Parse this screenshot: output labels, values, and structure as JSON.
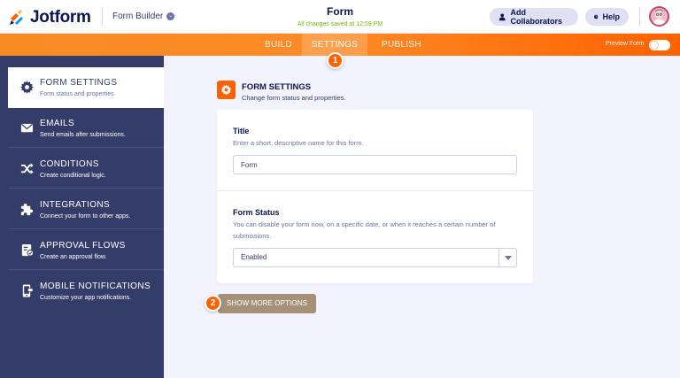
{
  "header": {
    "brand": "Jotform",
    "builder_label": "Form Builder",
    "builder_chevron": "⌄",
    "form_title": "Form",
    "save_status": "All changes saved at 12:59 PM",
    "add_collaborators": "Add Collaborators",
    "help": "Help"
  },
  "nav": {
    "tabs": [
      "BUILD",
      "SETTINGS",
      "PUBLISH"
    ],
    "active_tab": "SETTINGS",
    "preview_label": "Preview Form"
  },
  "markers": [
    "1",
    "2"
  ],
  "sidebar": {
    "items": [
      {
        "title": "FORM SETTINGS",
        "subtitle": "Form status and properties.",
        "icon": "gear-icon",
        "active": true
      },
      {
        "title": "EMAILS",
        "subtitle": "Send emails after submissions.",
        "icon": "envelope-icon",
        "active": false
      },
      {
        "title": "CONDITIONS",
        "subtitle": "Create conditional logic.",
        "icon": "shuffle-icon",
        "active": false
      },
      {
        "title": "INTEGRATIONS",
        "subtitle": "Connect your form to other apps.",
        "icon": "puzzle-icon",
        "active": false
      },
      {
        "title": "APPROVAL FLOWS",
        "subtitle": "Create an approval flow.",
        "icon": "approval-icon",
        "active": false
      },
      {
        "title": "MOBILE NOTIFICATIONS",
        "subtitle": "Customize your app notifications.",
        "icon": "mobile-icon",
        "active": false
      }
    ]
  },
  "main": {
    "section_title": "FORM SETTINGS",
    "section_subtitle": "Change form status and properties.",
    "title_field": {
      "label": "Title",
      "description": "Enter a short, descriptive name for this form.",
      "value": "Form"
    },
    "status_field": {
      "label": "Form Status",
      "description": "You can disable your form now, on a specific date, or when it reaches a certain number of submissions.",
      "value": "Enabled"
    },
    "show_more_button": "SHOW MORE OPTIONS"
  },
  "colors": {
    "brand_orange": "#ff6100",
    "sidebar_bg": "#343c6a",
    "accent_navy": "#0a1551",
    "saved_green": "#78bb07",
    "button_tan": "#a5917a"
  }
}
